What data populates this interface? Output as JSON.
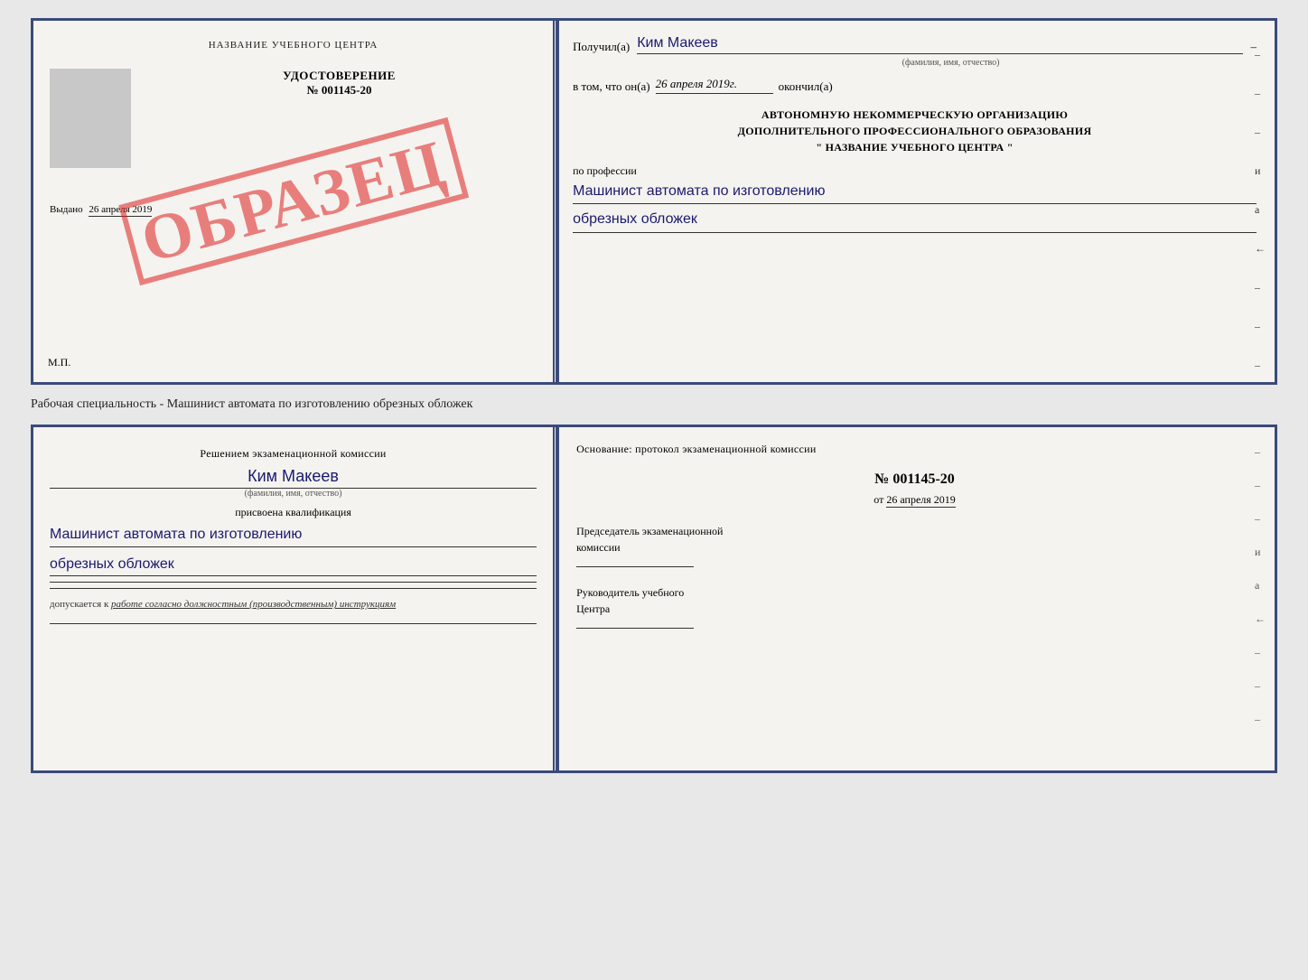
{
  "doc1": {
    "left": {
      "title": "НАЗВАНИЕ УЧЕБНОГО ЦЕНТРА",
      "stamp": "ОБРАЗЕЦ",
      "cert_label": "УДОСТОВЕРЕНИЕ",
      "cert_number": "№ 001145-20",
      "issued_label": "Выдано",
      "issued_date": "26 апреля 2019",
      "mp": "М.П."
    },
    "right": {
      "recipient_label": "Получил(а)",
      "recipient_name": "Ким Макеев",
      "recipient_dash": "–",
      "fio_hint": "(фамилия, имя, отчество)",
      "date_label": "в том, что он(а)",
      "date_value": "26 апреля 2019г.",
      "date_suffix": "окончил(а)",
      "org_line1": "АВТОНОМНУЮ НЕКОММЕРЧЕСКУЮ ОРГАНИЗАЦИЮ",
      "org_line2": "ДОПОЛНИТЕЛЬНОГО ПРОФЕССИОНАЛЬНОГО ОБРАЗОВАНИЯ",
      "org_line3": "\"  НАЗВАНИЕ УЧЕБНОГО ЦЕНТРА  \"",
      "profession_label": "по профессии",
      "profession_line1": "Машинист автомата по изготовлению",
      "profession_line2": "обрезных обложек",
      "margin_chars": [
        "–",
        "–",
        "–",
        "–",
        "и",
        "а",
        "←",
        "–",
        "–",
        "–"
      ]
    }
  },
  "between_label": "Рабочая специальность - Машинист автомата по изготовлению обрезных обложек",
  "doc2": {
    "left": {
      "commission_line1": "Решением экзаменационной комиссии",
      "person_name": "Ким Макеев",
      "fio_hint": "(фамилия, имя, отчество)",
      "qualification_label": "присвоена квалификация",
      "qualification_line1": "Машинист автомата по изготовлению",
      "qualification_line2": "обрезных обложек",
      "допуск_prefix": "допускается к",
      "допуск_italic": "работе согласно должностным (производственным) инструкциям"
    },
    "right": {
      "osnova_label": "Основание: протокол экзаменационной комиссии",
      "protocol_number": "№  001145-20",
      "protocol_date_prefix": "от",
      "protocol_date": "26 апреля 2019",
      "chairman_label": "Председатель экзаменационной",
      "chairman_label2": "комиссии",
      "head_label": "Руководитель учебного",
      "head_label2": "Центра",
      "margin_chars": [
        "–",
        "–",
        "–",
        "–",
        "и",
        "а",
        "←",
        "–",
        "–",
        "–"
      ]
    }
  }
}
